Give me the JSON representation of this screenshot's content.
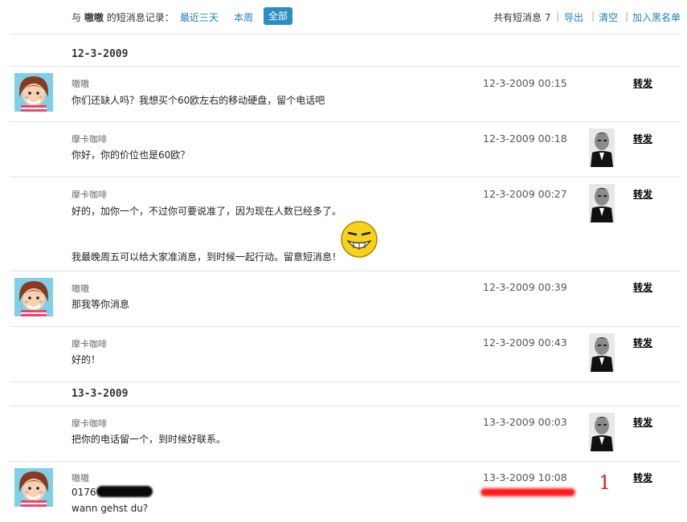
{
  "header": {
    "prefix": "与",
    "contact": "嗷嗷",
    "suffix": "的短消息记录：",
    "filters": [
      "最近三天",
      "本周",
      "全部"
    ],
    "count_label": "共有短消息 7",
    "actions": [
      "导出",
      "清空",
      "加入黑名单"
    ]
  },
  "groups": [
    {
      "date": "12-3-2009"
    },
    {
      "date": "13-3-2009"
    }
  ],
  "messages": [
    {
      "sender": "嗷嗷",
      "lines": [
        "你们还缺人吗？我想买个60欧左右的移动硬盘，留个电话吧"
      ],
      "time": "12-3-2009 00:15",
      "forward": "转发"
    },
    {
      "sender": "摩卡咖啡",
      "lines": [
        "你好，你的价位也是60欧？"
      ],
      "time": "12-3-2009 00:18",
      "forward": "转发"
    },
    {
      "sender": "摩卡咖啡",
      "lines": [
        "好的，加你一个，不过你可要说准了，因为现在人数已经多了。",
        "我最晚周五可以给大家准消息，到时候一起行动。留意短消息！"
      ],
      "time": "12-3-2009 00:27",
      "forward": "转发"
    },
    {
      "sender": "嗷嗷",
      "lines": [
        "那我等你消息"
      ],
      "time": "12-3-2009 00:39",
      "forward": "转发"
    },
    {
      "sender": "摩卡咖啡",
      "lines": [
        "好的！"
      ],
      "time": "12-3-2009 00:43",
      "forward": "转发"
    },
    {
      "sender": "摩卡咖啡",
      "lines": [
        "把你的电话留一个，到时候好联系。"
      ],
      "time": "13-3-2009 00:03",
      "forward": "转发"
    },
    {
      "sender": "嗷嗷",
      "lines": [
        "0176",
        "wann gehst du?"
      ],
      "time": "13-3-2009 10:08",
      "forward": "转发"
    }
  ],
  "annotation": "1",
  "icons": {
    "girl_avatar": "girl-avatar-icon",
    "man_avatar": "man-photo-avatar-icon",
    "smiley": "grinning-smiley-icon"
  }
}
